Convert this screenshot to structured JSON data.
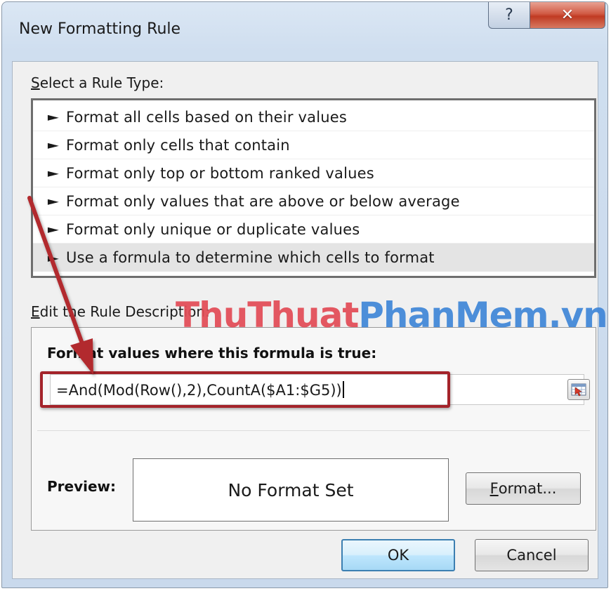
{
  "window": {
    "title": "New Formatting Rule",
    "help_glyph": "?",
    "close_glyph": "✕"
  },
  "rule_type": {
    "label_accel": "S",
    "label_rest": "elect a Rule Type:",
    "items": [
      {
        "label": "Format all cells based on their values"
      },
      {
        "label": "Format only cells that contain"
      },
      {
        "label": "Format only top or bottom ranked values"
      },
      {
        "label": "Format only values that are above or below average"
      },
      {
        "label": "Format only unique or duplicate values"
      },
      {
        "label": "Use a formula to determine which cells to format"
      }
    ],
    "selected_index": 5,
    "bullet_glyph": "►"
  },
  "rule_description": {
    "label_accel": "E",
    "label_rest": "dit the Rule Description:",
    "formula_caption": "Format values where this formula is true:",
    "formula_value": "=And(Mod(Row(),2),CountA($A1:$G5))",
    "preview_label": "Preview:",
    "preview_text": "No Format Set",
    "format_button_accel": "F",
    "format_button_rest": "ormat..."
  },
  "footer": {
    "ok_label": "OK",
    "cancel_label": "Cancel"
  },
  "watermark": {
    "part_red": "ThuThuat",
    "part_blue": "PhanMem.vn"
  },
  "colors": {
    "highlight_frame": "#a4232a",
    "annotation_arrow": "#b22a2f",
    "selected_row": "#e4e4e4",
    "close_button": "#c9462f",
    "watermark_red": "#e24b55",
    "watermark_blue": "#3f86d8"
  }
}
